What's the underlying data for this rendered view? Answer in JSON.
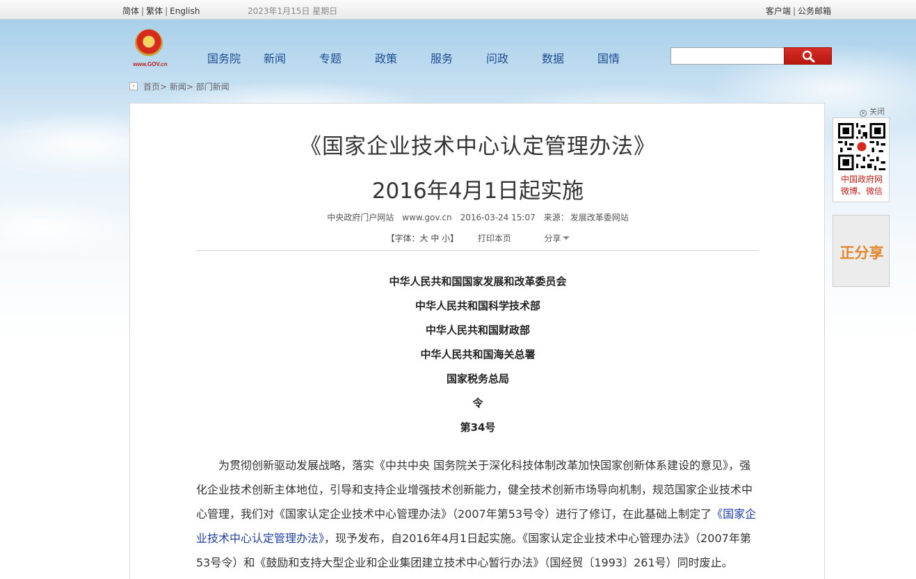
{
  "topbar": {
    "lang_simplified": "简体",
    "lang_traditional": "繁体",
    "lang_english": "English",
    "date": "2023年1月15日 星期日",
    "client_link": "客户端",
    "mail_link": "公务邮箱",
    "separator": "|"
  },
  "logo": {
    "text": "www.GOV.cn"
  },
  "nav": [
    "国务院",
    "新闻",
    "专题",
    "政策",
    "服务",
    "问政",
    "数据",
    "国情"
  ],
  "search": {
    "value": "",
    "placeholder": ""
  },
  "breadcrumb": "首页> 新闻> 部门新闻",
  "article": {
    "title_line1": "《国家企业技术中心认定管理办法》",
    "title_line2": "2016年4月1日起实施",
    "meta": {
      "source_site": "中央政府门户网站",
      "domain": "www.gov.cn",
      "datetime": "2016-03-24 15:07",
      "source_label": "来源：",
      "source": "发展改革委网站"
    },
    "tools": {
      "font_label": "【字体：",
      "font_large": "大",
      "font_medium": "中",
      "font_small": "小",
      "font_close": "】",
      "print": "打印本页",
      "share": "分享"
    },
    "issuers": [
      "中华人民共和国国家发展和改革委员会",
      "中华人民共和国科学技术部",
      "中华人民共和国财政部",
      "中华人民共和国海关总署",
      "国家税务总局",
      "令",
      "第34号"
    ],
    "body_part1": "为贯彻创新驱动发展战略，落实《中共中央 国务院关于深化科技体制改革加快国家创新体系建设的意见》，强化企业技术创新主体地位，引导和支持企业增强技术创新能力，健全技术创新市场导向机制，规范国家企业技术中心管理，我们对《国家认定企业技术中心管理办法》（2007年第53号令）进行了修订，在此基础上制定了",
    "body_link": "《国家企业技术中心认定管理办法》",
    "body_part2": "，现予发布，自2016年4月1日起实施。《国家认定企业技术中心管理办法》（2007年第53号令）和《鼓励和支持大型企业和企业集团建立技术中心暂行办法》（国经贸〔1993〕261号）同时废止。"
  },
  "sidebar": {
    "close_label": "关闭",
    "qr_line1": "中国政府网",
    "qr_line2": "微博、微信",
    "share_brand": "正分享"
  },
  "colors": {
    "nav_text": "#1f4c91",
    "search_button": "#c8221a",
    "link": "#1f3ea8",
    "qr_text": "#c81d17",
    "share_brand": "#e2852b"
  }
}
